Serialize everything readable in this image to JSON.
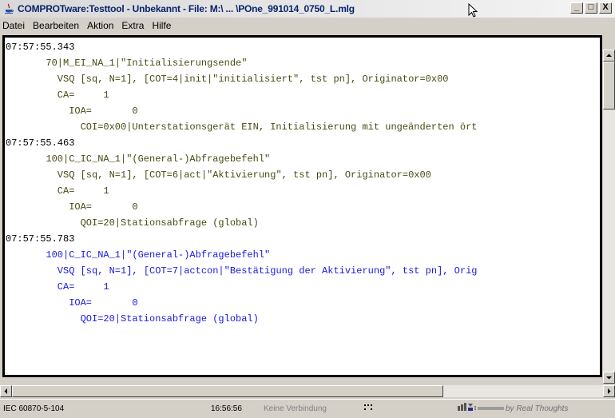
{
  "window": {
    "title": "COMPROTware:Testtool - Unbekannt - File: M:\\ ... \\POne_991014_0750_L.mlg",
    "minimize": "_",
    "maximize": "□",
    "close": "X"
  },
  "menu": [
    "Datei",
    "Bearbeiten",
    "Aktion",
    "Extra",
    "Hilfe"
  ],
  "colors": {
    "black_text": "#000000",
    "olive_text": "#4a4a14",
    "blue_text": "#1a1adc"
  },
  "log": [
    {
      "indent": 0,
      "color": "black",
      "text": "07:57:55.343"
    },
    {
      "indent": 7,
      "color": "olive",
      "text": "70|M_EI_NA_1|\"Initialisierungsende\""
    },
    {
      "indent": 9,
      "color": "olive",
      "text": "VSQ [sq, N=1], [COT=4|init|\"initialisiert\", tst pn], Originator=0x00"
    },
    {
      "indent": 9,
      "color": "olive",
      "text": "CA=     1"
    },
    {
      "indent": 11,
      "color": "olive",
      "text": "IOA=       0"
    },
    {
      "indent": 13,
      "color": "olive",
      "text": "COI=0x00|Unterstationsgerät EIN, Initialisierung mit ungeänderten ört"
    },
    {
      "indent": 0,
      "color": "black",
      "text": "07:57:55.463"
    },
    {
      "indent": 7,
      "color": "olive",
      "text": "100|C_IC_NA_1|\"(General-)Abfragebefehl\""
    },
    {
      "indent": 9,
      "color": "olive",
      "text": "VSQ [sq, N=1], [COT=6|act|\"Aktivierung\", tst pn], Originator=0x00"
    },
    {
      "indent": 9,
      "color": "olive",
      "text": "CA=     1"
    },
    {
      "indent": 11,
      "color": "olive",
      "text": "IOA=       0"
    },
    {
      "indent": 13,
      "color": "olive",
      "text": "QOI=20|Stationsabfrage (global)"
    },
    {
      "indent": 0,
      "color": "black",
      "text": "07:57:55.783"
    },
    {
      "indent": 7,
      "color": "blue",
      "text": "100|C_IC_NA_1|\"(General-)Abfragebefehl\""
    },
    {
      "indent": 9,
      "color": "blue",
      "text": "VSQ [sq, N=1], [COT=7|actcon|\"Bestätigung der Aktivierung\", tst pn], Orig"
    },
    {
      "indent": 9,
      "color": "blue",
      "text": "CA=     1"
    },
    {
      "indent": 11,
      "color": "blue",
      "text": "IOA=       0"
    },
    {
      "indent": 13,
      "color": "blue",
      "text": "QOI=20|Stationsabfrage (global)"
    }
  ],
  "status": {
    "protocol": "IEC 60870-5-104",
    "time": "16:56:56",
    "connection": "Keine Verbindung",
    "brand": "by Real Thoughts"
  }
}
